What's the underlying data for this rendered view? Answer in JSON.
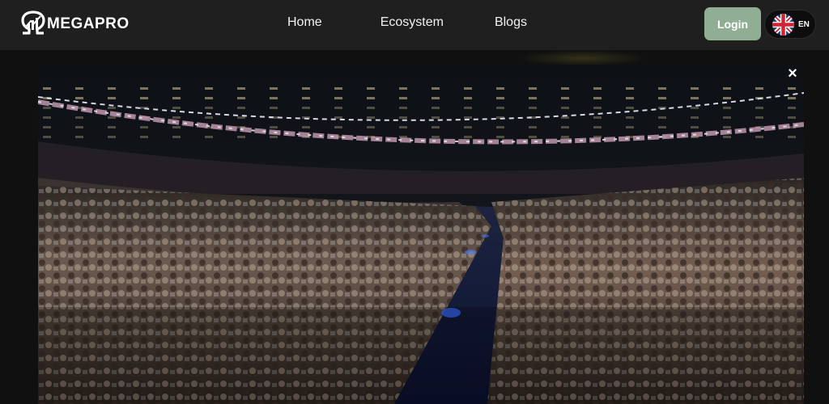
{
  "header": {
    "logo_text": "MEGAPRO",
    "nav": [
      {
        "label": "Home"
      },
      {
        "label": "Ecosystem"
      },
      {
        "label": "Blogs"
      }
    ],
    "login_label": "Login",
    "language": {
      "code": "EN",
      "flag_icon": "uk-flag-icon"
    }
  },
  "modal": {
    "close_label": "×",
    "content": "concert-crowd-video"
  },
  "colors": {
    "navbar_bg": "#1f1f1f",
    "login_bg": "#8fae93",
    "page_bg": "#0e0e0e"
  }
}
